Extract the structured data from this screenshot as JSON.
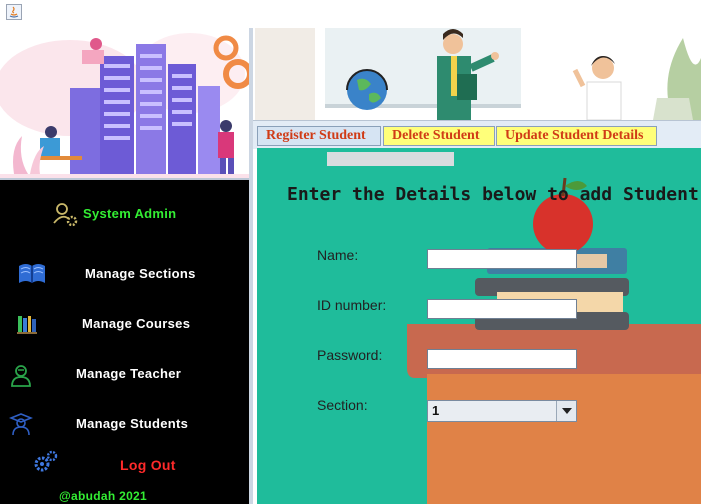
{
  "sidebar": {
    "admin_title": "System Admin",
    "items": [
      {
        "label": "Manage  Sections"
      },
      {
        "label": "Manage Courses"
      },
      {
        "label": "Manage Teacher"
      },
      {
        "label": "Manage Students"
      }
    ],
    "logout_label": "Log Out",
    "footer": "@abudah 2021"
  },
  "tabs": [
    {
      "label": "Register Student",
      "active": true
    },
    {
      "label": "Delete Student",
      "active": false
    },
    {
      "label": "Update Student Details",
      "active": false
    }
  ],
  "form": {
    "heading": "Enter the Details below to add Student",
    "name_label": "Name:",
    "name_value": "",
    "id_label": "ID number:",
    "id_value": "",
    "password_label": "Password:",
    "password_value": "",
    "section_label": "Section:",
    "section_value": "1"
  },
  "colors": {
    "content_bg": "#1fbc9b",
    "sidebar_bg": "#000000",
    "admin_text": "#33ee33",
    "logout_text": "#ff2a2a",
    "tab_text": "#d03b16",
    "tab_bg": "#ffff7a"
  },
  "icons": [
    "java-app-icon",
    "admin-gear-user-icon",
    "book-icon",
    "books-shelf-icon",
    "teacher-icon",
    "student-icon",
    "gears-icon",
    "dropdown-arrow-icon"
  ]
}
